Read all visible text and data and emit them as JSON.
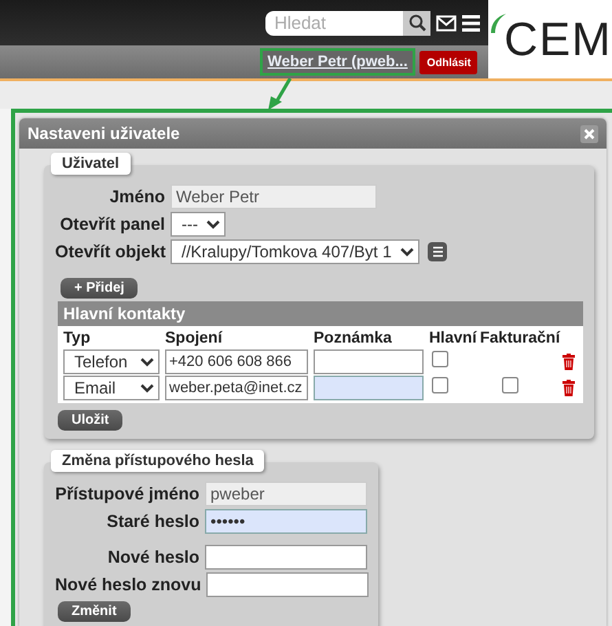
{
  "header": {
    "search": {
      "placeholder": "Hledat"
    },
    "logo": "CEM",
    "user_link": "Weber Petr (pweb...",
    "logout_button": "Odhlásit"
  },
  "dialog": {
    "title": "Nastaveni uživatele",
    "user_group": {
      "legend": "Uživatel",
      "fields": [
        {
          "kind": "text",
          "label": "Jméno",
          "value": "Weber Petr"
        },
        {
          "kind": "select",
          "label": "Otevřít panel",
          "value": "---"
        },
        {
          "kind": "select-icon",
          "label": "Otevřít objekt",
          "value": "//Kralupy/Tomkova 407/Byt 1"
        }
      ],
      "add_button": "+ Přidej",
      "contacts": {
        "title": "Hlavní kontakty",
        "columns": [
          "Typ",
          "Spojení",
          "Poznámka",
          "Hlavní",
          "Fakturační"
        ],
        "rows": [
          {
            "type": "Telefon",
            "connection": "+420 606 608 866",
            "note_highlighted": false,
            "main": false
          },
          {
            "type": "Email",
            "connection": "weber.peta@inet.cz",
            "note_highlighted": true,
            "main": false,
            "billing": false
          }
        ]
      },
      "save_button": "Uložit"
    },
    "password_group": {
      "legend": "Změna přístupového hesla",
      "fields": [
        {
          "label": "Přístupové jméno",
          "value": "pweber",
          "readonly": true,
          "highlighted": false
        },
        {
          "label": "Staré heslo",
          "value": "••••••",
          "readonly": false,
          "highlighted": true
        },
        {
          "label": "Nové heslo",
          "readonly": false,
          "highlighted": false,
          "gap": true
        },
        {
          "label": "Nové heslo znovu",
          "readonly": false,
          "highlighted": false
        }
      ],
      "change_button": "Změnit"
    }
  }
}
